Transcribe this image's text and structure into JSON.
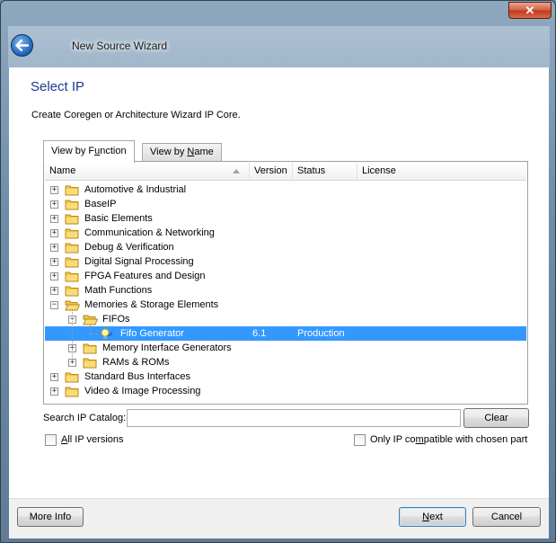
{
  "window": {
    "title": "New Source Wizard",
    "close_label": "✕"
  },
  "page": {
    "title": "Select IP",
    "description": "Create Coregen or Architecture Wizard IP Core."
  },
  "tabs": [
    {
      "label_pre": "View by F",
      "label_ul": "u",
      "label_post": "nction"
    },
    {
      "label_pre": "View by ",
      "label_ul": "N",
      "label_post": "ame"
    }
  ],
  "columns": {
    "name": "Name",
    "version": "Version",
    "status": "Status",
    "license": "License"
  },
  "tree": [
    {
      "label": "Automotive & Industrial",
      "level": 0,
      "expander": "+"
    },
    {
      "label": "BaseIP",
      "level": 0,
      "expander": "+"
    },
    {
      "label": "Basic Elements",
      "level": 0,
      "expander": "+"
    },
    {
      "label": "Communication & Networking",
      "level": 0,
      "expander": "+"
    },
    {
      "label": "Debug & Verification",
      "level": 0,
      "expander": "+"
    },
    {
      "label": "Digital Signal Processing",
      "level": 0,
      "expander": "+"
    },
    {
      "label": "FPGA Features and Design",
      "level": 0,
      "expander": "+"
    },
    {
      "label": "Math Functions",
      "level": 0,
      "expander": "+"
    },
    {
      "label": "Memories & Storage Elements",
      "level": 0,
      "expander": "−"
    },
    {
      "label": "FIFOs",
      "level": 1,
      "expander": "−"
    },
    {
      "label": "Fifo Generator",
      "level": 2,
      "version": "6.1",
      "status": "Production"
    },
    {
      "label": "Memory Interface Generators",
      "level": 1,
      "expander": "+"
    },
    {
      "label": "RAMs & ROMs",
      "level": 1,
      "expander": "+"
    },
    {
      "label": "Standard Bus Interfaces",
      "level": 0,
      "expander": "+"
    },
    {
      "label": "Video & Image Processing",
      "level": 0,
      "expander": "+"
    }
  ],
  "search": {
    "label_pre": "Search IP Catalo",
    "label_ul": "g",
    "label_post": ":",
    "value": "",
    "clear_label": "Clear"
  },
  "options": {
    "all_versions_ul": "A",
    "all_versions_rest": "ll IP versions",
    "all_versions_checked": false,
    "compatible_pre": "Only IP co",
    "compatible_ul": "m",
    "compatible_post": "patible with chosen part",
    "compatible_checked": false
  },
  "footer": {
    "more_info": "More Info",
    "next_ul": "N",
    "next_rest": "ext",
    "cancel": "Cancel"
  },
  "colors": {
    "selection": "#3399ff",
    "title_blue": "#1e3a8a",
    "folder_yellow": "#f5c542"
  }
}
